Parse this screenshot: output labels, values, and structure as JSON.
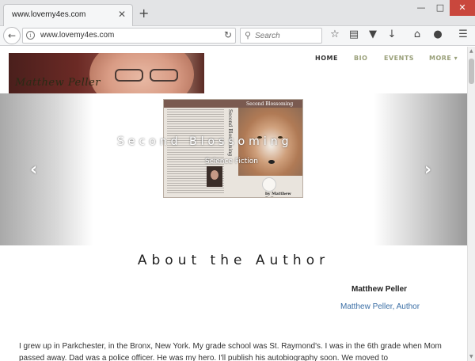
{
  "browser": {
    "tab_title": "www.lovemy4es.com",
    "tab_close": "✕",
    "new_tab": "+",
    "url": "www.lovemy4es.com",
    "search_placeholder": "Search",
    "window_min": "—",
    "window_max": "□",
    "window_close": "✕"
  },
  "site": {
    "logo_name": "Matthew Peller",
    "menu": [
      {
        "label": "HOME",
        "color": "#333333"
      },
      {
        "label": "BIO",
        "color": "#9aa07a"
      },
      {
        "label": "EVENTS",
        "color": "#9aa07a"
      },
      {
        "label": "MORE ▾",
        "color": "#9aa07a"
      }
    ]
  },
  "slider": {
    "prev": "‹",
    "next": "›",
    "caption_title": "Second Blossoming",
    "caption_subtitle": "Science Fiction",
    "book": {
      "title": "Second Blossoming",
      "spine": "Second Blossoming",
      "author": "by Matthew Peller"
    }
  },
  "about": {
    "heading": "About the Author",
    "name": "Matthew Peller",
    "link": "Matthew Peller, Author",
    "bio_text": "I grew up in Parkchester, in the Bronx, New York. My grade school was St. Raymond's. I was in the 6th grade when Mom passed away. Dad was a police officer. He was my hero. I'll publish his autobiography soon. We moved to"
  }
}
